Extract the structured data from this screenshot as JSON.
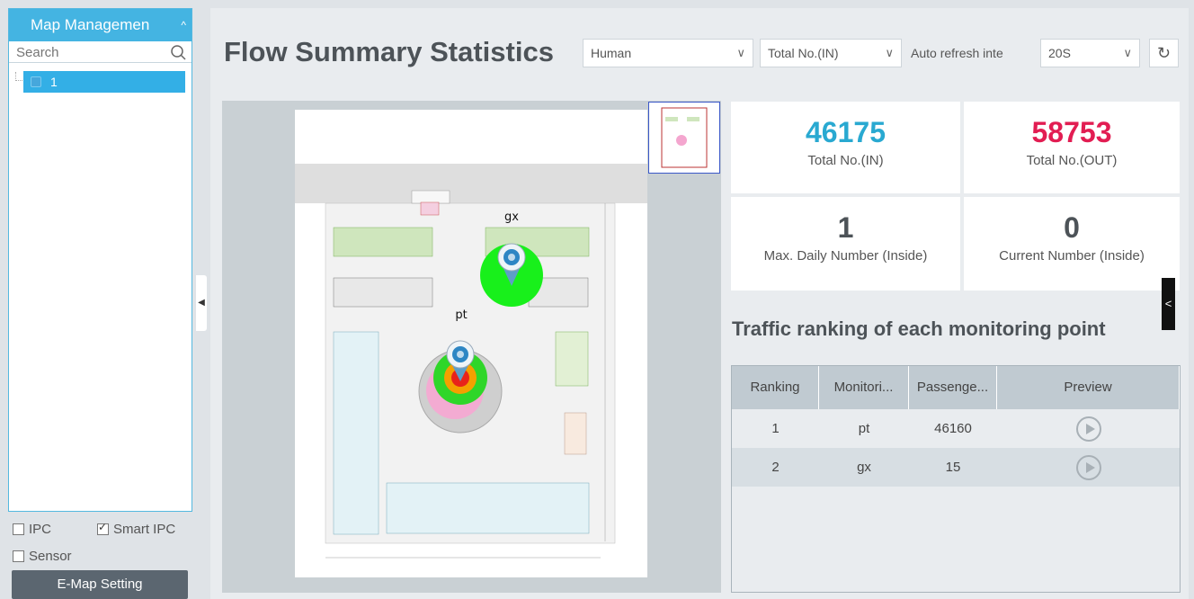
{
  "left_panel": {
    "title": "Map Managemen",
    "search_placeholder": "Search",
    "tree_node": "1",
    "checkbox_ipc": "IPC",
    "checkbox_smart_ipc": "Smart IPC",
    "checkbox_sensor": "Sensor",
    "checkbox_states": {
      "ipc": false,
      "smart_ipc": true,
      "sensor": false
    },
    "emap_button": "E-Map Setting"
  },
  "header": {
    "title": "Flow Summary Statistics",
    "target_select": "Human",
    "count_select": "Total No.(IN)",
    "refresh_label": "Auto refresh inte",
    "refresh_select": "20S"
  },
  "map": {
    "points": [
      {
        "label": "gx"
      },
      {
        "label": "pt"
      }
    ]
  },
  "stats": {
    "total_in": {
      "value": "46175",
      "label": "Total No.(IN)",
      "color": "#29a9d1"
    },
    "total_out": {
      "value": "58753",
      "label": "Total No.(OUT)",
      "color": "#e21d52"
    },
    "max_daily": {
      "value": "1",
      "label": "Max. Daily Number (Inside)"
    },
    "current": {
      "value": "0",
      "label": "Current Number (Inside)"
    }
  },
  "side_tab": "<",
  "ranking": {
    "title": "Traffic ranking of each monitoring point",
    "columns": [
      "Ranking",
      "Monitori...",
      "Passenge...",
      "Preview"
    ],
    "rows": [
      {
        "rank": "1",
        "point": "pt",
        "count": "46160"
      },
      {
        "rank": "2",
        "point": "gx",
        "count": "15"
      }
    ]
  }
}
